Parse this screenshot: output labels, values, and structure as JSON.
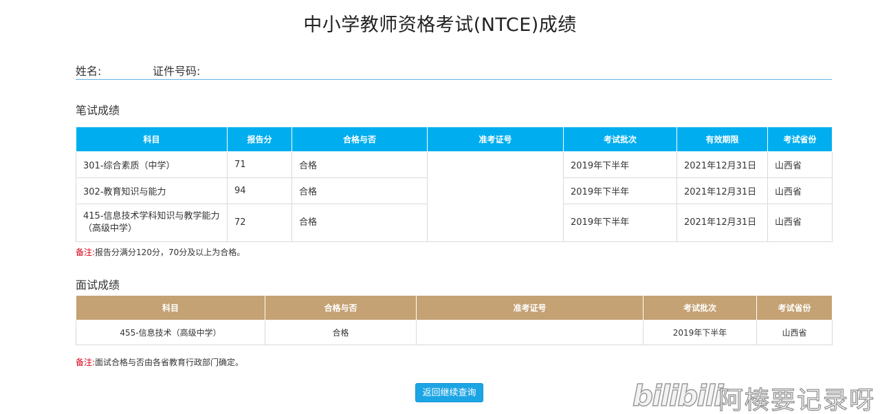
{
  "page": {
    "title": "中小学教师资格考试(NTCE)成绩"
  },
  "info": {
    "name_label": "姓名:",
    "id_label": "证件号码:"
  },
  "written": {
    "section_title": "笔试成绩",
    "headers": [
      "科目",
      "报告分",
      "合格与否",
      "准考证号",
      "考试批次",
      "有效期限",
      "考试省份"
    ],
    "rows": [
      {
        "subject": "301-综合素质（中学）",
        "score": "71",
        "pass": "合格",
        "exam_no": "",
        "batch": "2019年下半年",
        "valid": "2021年12月31日",
        "province": "山西省"
      },
      {
        "subject": "302-教育知识与能力",
        "score": "94",
        "pass": "合格",
        "exam_no": "",
        "batch": "2019年下半年",
        "valid": "2021年12月31日",
        "province": "山西省"
      },
      {
        "subject": "415-信息技术学科知识与教学能力（高级中学）",
        "score": "72",
        "pass": "合格",
        "exam_no": "",
        "batch": "2019年下半年",
        "valid": "2021年12月31日",
        "province": "山西省"
      }
    ],
    "note_label": "备注:",
    "note_text": "报告分满分120分，70分及以上为合格。"
  },
  "oral": {
    "section_title": "面试成绩",
    "headers": [
      "科目",
      "合格与否",
      "准考证号",
      "考试批次",
      "考试省份"
    ],
    "rows": [
      {
        "subject": "455-信息技术（高级中学）",
        "pass": "合格",
        "exam_no": "",
        "batch": "2019年下半年",
        "province": "山西省"
      }
    ],
    "note_label": "备注:",
    "note_text": "面试合格与否由各省教育行政部门确定。"
  },
  "actions": {
    "back_label": "返回继续查询"
  },
  "watermark": {
    "logo": "bilibili",
    "text": "阿楱要记录呀"
  },
  "colors": {
    "written_header": "#00aeef",
    "oral_header": "#c4a273",
    "button": "#1ca5e4",
    "note_red": "#d9001b",
    "divider": "#5fb3e6"
  }
}
